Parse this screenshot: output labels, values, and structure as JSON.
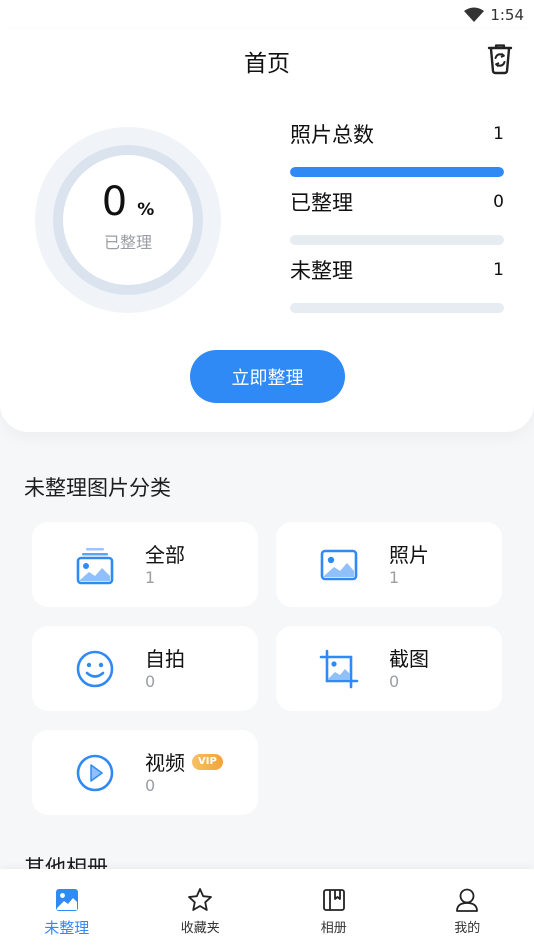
{
  "status_bar": {
    "time": "1:54"
  },
  "header": {
    "title": "首页"
  },
  "summary": {
    "percent": "0",
    "percent_unit": "%",
    "percent_label": "已整理",
    "progress": 0,
    "stats": [
      {
        "label": "照片总数",
        "value": "1",
        "fill": 1.0
      },
      {
        "label": "已整理",
        "value": "0",
        "fill": 0
      },
      {
        "label": "未整理",
        "value": "1",
        "fill": 0
      }
    ],
    "action_label": "立即整理"
  },
  "categories_section": {
    "title": "未整理图片分类",
    "items": [
      {
        "name": "全部",
        "count": "1",
        "icon": "stack-photo-icon"
      },
      {
        "name": "照片",
        "count": "1",
        "icon": "photo-icon"
      },
      {
        "name": "自拍",
        "count": "0",
        "icon": "smile-icon"
      },
      {
        "name": "截图",
        "count": "0",
        "icon": "screenshot-icon"
      },
      {
        "name": "视频",
        "count": "0",
        "icon": "play-icon",
        "badge": "VIP"
      }
    ]
  },
  "other_section": {
    "title": "其他相册"
  },
  "bottom_nav": {
    "items": [
      {
        "label": "未整理",
        "icon": "photo-tab-icon",
        "active": true
      },
      {
        "label": "收藏夹",
        "icon": "star-icon",
        "active": false
      },
      {
        "label": "相册",
        "icon": "album-icon",
        "active": false
      },
      {
        "label": "我的",
        "icon": "user-icon",
        "active": false
      }
    ]
  },
  "colors": {
    "accent": "#2f8af5",
    "badge": "#f3a33b",
    "track": "#e7ebf2"
  }
}
